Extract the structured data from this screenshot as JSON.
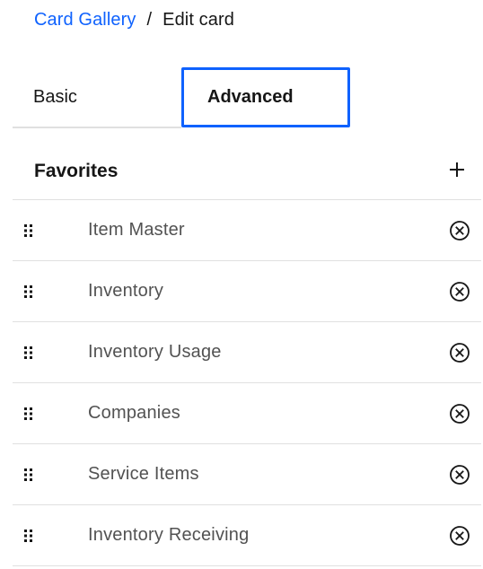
{
  "breadcrumb": {
    "parent": "Card Gallery",
    "separator": "/",
    "current": "Edit card"
  },
  "tabs": [
    {
      "label": "Basic",
      "selected": false
    },
    {
      "label": "Advanced",
      "selected": true
    }
  ],
  "favorites": {
    "title": "Favorites",
    "add_icon": "plus-icon",
    "remove_icon": "close-outline-icon",
    "drag_icon": "draggable-icon",
    "items": [
      {
        "label": "Item Master"
      },
      {
        "label": "Inventory"
      },
      {
        "label": "Inventory Usage"
      },
      {
        "label": "Companies"
      },
      {
        "label": "Service Items"
      },
      {
        "label": "Inventory Receiving"
      }
    ]
  },
  "colors": {
    "accent": "#0f62fe",
    "text_primary": "#161616",
    "text_secondary": "#525252",
    "divider": "#e0e0e0"
  }
}
